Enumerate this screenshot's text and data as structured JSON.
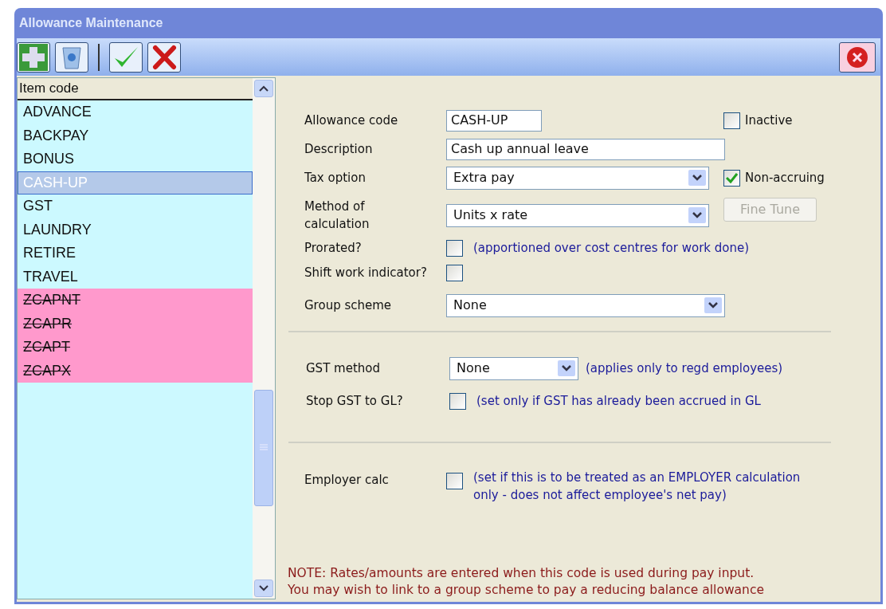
{
  "window": {
    "title": "Allowance Maintenance"
  },
  "list": {
    "header": "Item code",
    "items": [
      {
        "code": "ADVANCE",
        "selected": false,
        "inactive": false
      },
      {
        "code": "BACKPAY",
        "selected": false,
        "inactive": false
      },
      {
        "code": "BONUS",
        "selected": false,
        "inactive": false
      },
      {
        "code": "CASH-UP",
        "selected": true,
        "inactive": false
      },
      {
        "code": "GST",
        "selected": false,
        "inactive": false
      },
      {
        "code": "LAUNDRY",
        "selected": false,
        "inactive": false
      },
      {
        "code": "RETIRE",
        "selected": false,
        "inactive": false
      },
      {
        "code": "TRAVEL",
        "selected": false,
        "inactive": false
      },
      {
        "code": "ZCAPNT",
        "selected": false,
        "inactive": true
      },
      {
        "code": "ZCAPR",
        "selected": false,
        "inactive": true
      },
      {
        "code": "ZCAPT",
        "selected": false,
        "inactive": true
      },
      {
        "code": "ZCAPX",
        "selected": false,
        "inactive": true
      }
    ]
  },
  "form": {
    "allowance_code": {
      "label": "Allowance code",
      "value": "CASH-UP"
    },
    "inactive": {
      "label": "Inactive",
      "checked": false
    },
    "description": {
      "label": "Description",
      "value": "Cash up annual leave"
    },
    "tax_option": {
      "label": "Tax option",
      "value": "Extra pay"
    },
    "non_accruing": {
      "label": "Non-accruing",
      "checked": true
    },
    "method": {
      "label": "Method of calculation",
      "value": "Units x rate"
    },
    "fine_tune": {
      "label": "Fine Tune",
      "disabled": true
    },
    "prorated": {
      "label": "Prorated?",
      "checked": false,
      "note": "(apportioned over cost centres for work done)"
    },
    "shift_work": {
      "label": "Shift work indicator?",
      "checked": false
    },
    "group_scheme": {
      "label": "Group scheme",
      "value": "None"
    },
    "gst_method": {
      "label": "GST method",
      "value": "None",
      "note": "(applies only to regd employees)"
    },
    "stop_gst": {
      "label": "Stop GST to GL?",
      "checked": false,
      "note": "(set only if GST has already been accrued in GL"
    },
    "employer_calc": {
      "label": "Employer calc",
      "checked": false,
      "note": "(set if this is to be treated as an EMPLOYER calculation only - does not affect employee's net pay)"
    },
    "note": [
      "NOTE: Rates/amounts are entered when this code is used during pay input.",
      "You may wish to link to a group scheme to pay a reducing balance allowance"
    ]
  }
}
